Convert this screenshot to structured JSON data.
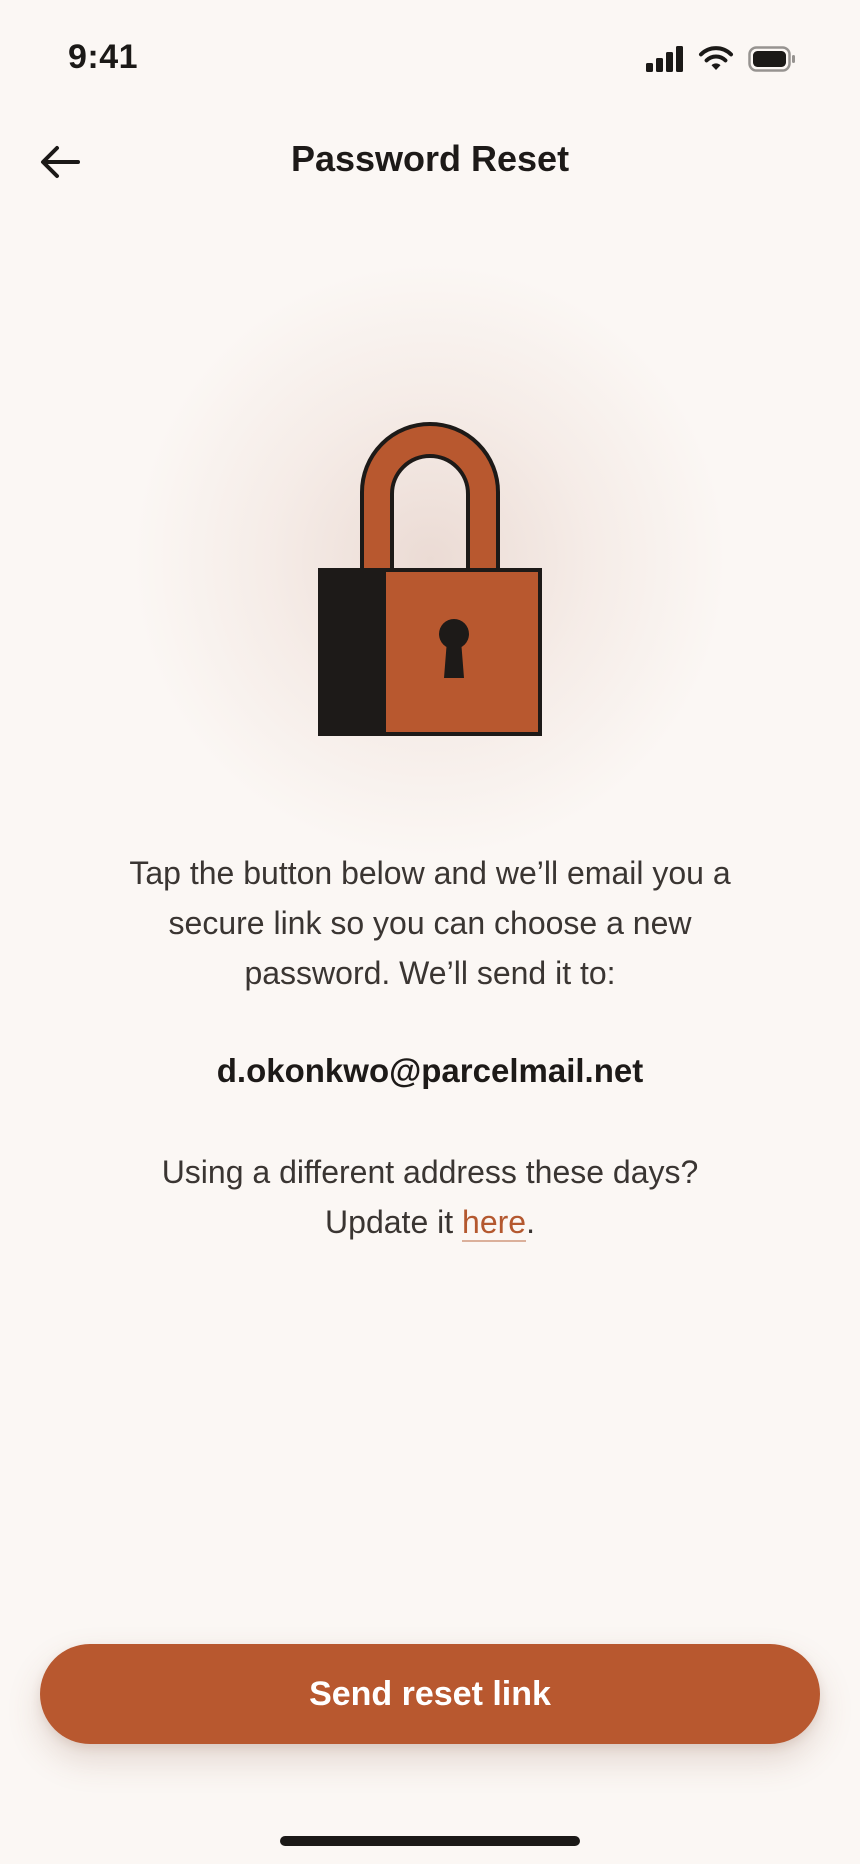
{
  "status_bar": {
    "time": "9:41",
    "icons": [
      "signal-icon",
      "wifi-icon",
      "battery-icon"
    ]
  },
  "nav": {
    "title": "Password Reset",
    "back_icon": "arrow-left-icon"
  },
  "hero": {
    "icon": "padlock-icon",
    "accent_color": "#b8582f",
    "dark_color": "#1d1a18"
  },
  "content": {
    "description": "Tap the button below and we’ll email you a secure link so you can choose a new password. We’ll send it to:",
    "email": "d.okonkwo@parcelmail.net",
    "update_prefix": "Using a different address these days? Update it ",
    "update_link": "here",
    "update_suffix": "."
  },
  "actions": {
    "primary_label": "Send reset link"
  },
  "colors": {
    "background": "#fbf7f4",
    "accent": "#b8582f",
    "text": "#1d1a18",
    "body_text": "#3a3532"
  }
}
